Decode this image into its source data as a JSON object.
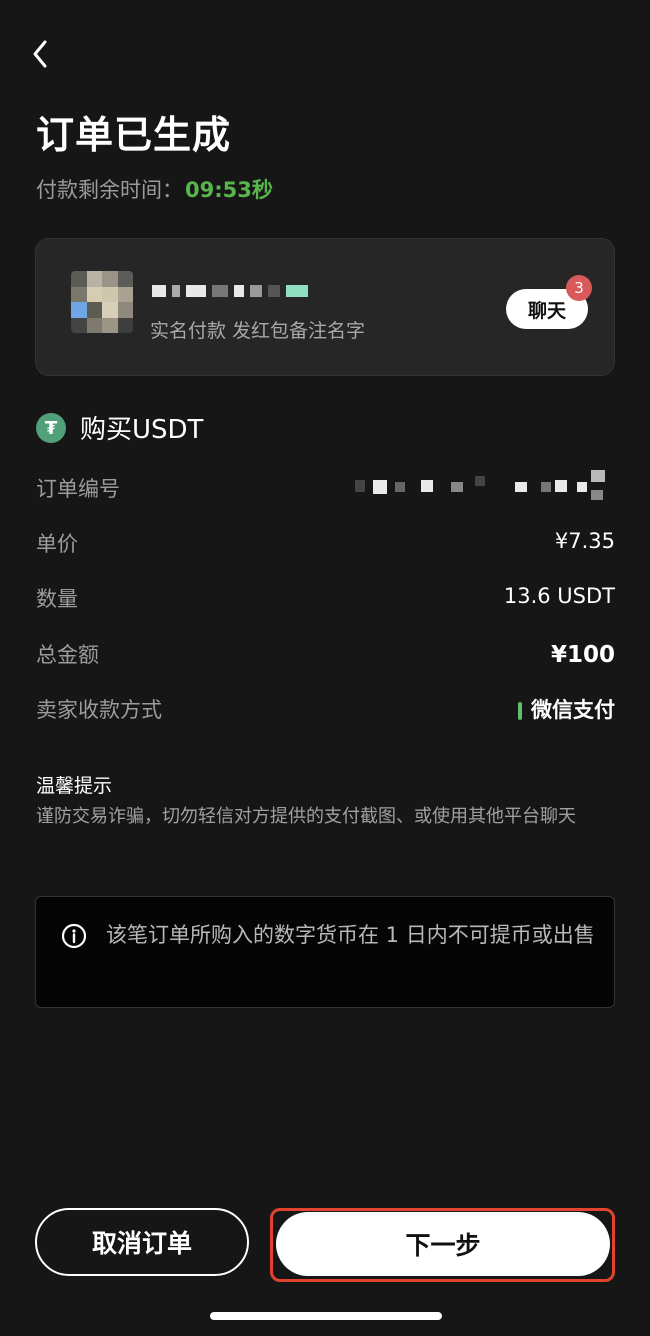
{
  "header": {
    "title": "订单已生成",
    "timer_label": "付款剩余时间：",
    "timer_value": "09:53秒"
  },
  "merchant": {
    "subtitle": "实名付款 发红包备注名字",
    "chat_label": "聊天",
    "chat_badge": "3"
  },
  "order": {
    "title": "购买USDT",
    "coin_symbol": "₮",
    "rows": [
      {
        "label": "订单编号",
        "value": ""
      },
      {
        "label": "单价",
        "value": "¥7.35"
      },
      {
        "label": "数量",
        "value": "13.6 USDT"
      },
      {
        "label": "总金额",
        "value": "¥100"
      },
      {
        "label": "卖家收款方式",
        "value": "微信支付"
      }
    ]
  },
  "tips": {
    "title": "温馨提示",
    "text": "谨防交易诈骗，切勿轻信对方提供的支付截图、或使用其他平台聊天"
  },
  "notice": {
    "text": "该笔订单所购入的数字货币在 1 日内不可提币或出售"
  },
  "actions": {
    "cancel_label": "取消订单",
    "next_label": "下一步"
  },
  "colors": {
    "background": "#161616",
    "timer_green": "#58b64c",
    "highlight_red": "#e0432e",
    "payment_green": "#5fbf6a"
  }
}
